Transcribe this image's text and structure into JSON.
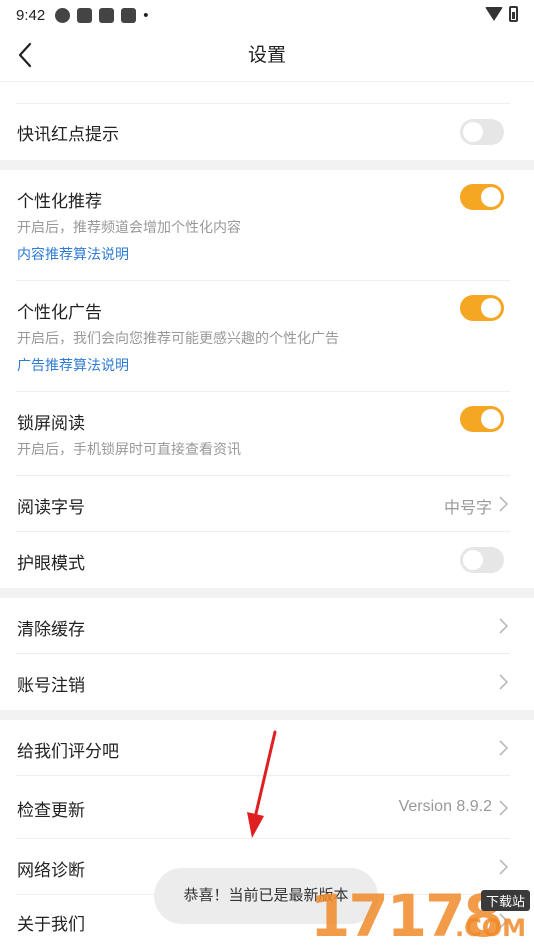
{
  "status_bar": {
    "time": "9:42",
    "dot": "•"
  },
  "header": {
    "title": "设置"
  },
  "rows": {
    "kuaixun": {
      "title": "快讯红点提示",
      "enabled": false
    },
    "personal_rec": {
      "title": "个性化推荐",
      "desc": "开启后，推荐频道会增加个性化内容",
      "link": "内容推荐算法说明",
      "enabled": true
    },
    "personal_ads": {
      "title": "个性化广告",
      "desc": "开启后，我们会向您推荐可能更感兴趣的个性化广告",
      "link": "广告推荐算法说明",
      "enabled": true
    },
    "lockscreen": {
      "title": "锁屏阅读",
      "desc": "开启后，手机锁屏时可直接查看资讯",
      "enabled": true
    },
    "font_size": {
      "title": "阅读字号",
      "value": "中号字"
    },
    "eye_mode": {
      "title": "护眼模式",
      "enabled": false
    },
    "clear_cache": {
      "title": "清除缓存"
    },
    "cancel_account": {
      "title": "账号注销"
    },
    "rate_us": {
      "title": "给我们评分吧"
    },
    "check_update": {
      "title": "检查更新",
      "value": "Version 8.9.2"
    },
    "network_diag": {
      "title": "网络诊断"
    },
    "about": {
      "title": "关于我们"
    }
  },
  "toast": {
    "text": "恭喜！当前已是最新版本"
  },
  "watermark": {
    "digits": "17178",
    "tag": "下载站",
    "com": ".COM"
  },
  "colors": {
    "toggle_on": "#f5a623",
    "toggle_off": "#e6e6e6",
    "link": "#2f7cd6",
    "annotation_arrow": "#e02020"
  }
}
